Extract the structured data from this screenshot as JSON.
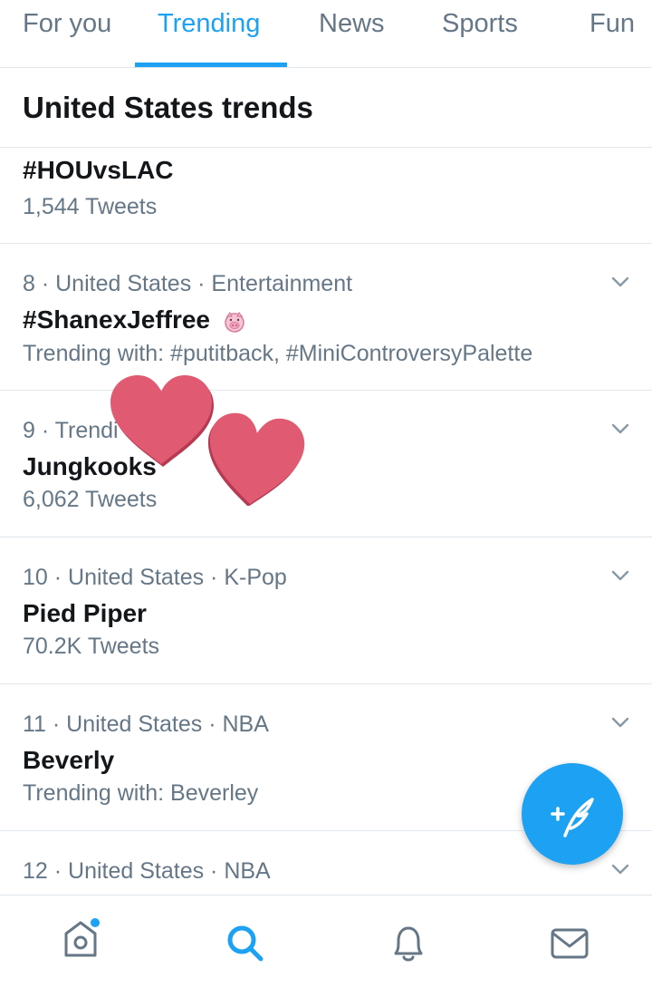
{
  "tabs": [
    {
      "label": "For you"
    },
    {
      "label": "Trending"
    },
    {
      "label": "News"
    },
    {
      "label": "Sports"
    },
    {
      "label": "Fun"
    }
  ],
  "section_title": "United States trends",
  "trends": [
    {
      "meta": "",
      "name": "#HOUvsLAC",
      "sub": "1,544 Tweets"
    },
    {
      "meta": "8 · United States · Entertainment",
      "name": "#ShanexJeffree",
      "sub": "Trending with: #putitback, #MiniControversyPalette"
    },
    {
      "meta": "9 · Trendi",
      "name": "Jungkooks",
      "sub": "6,062 Tweets"
    },
    {
      "meta": "10 · United States · K-Pop",
      "name": "Pied Piper",
      "sub": "70.2K Tweets"
    },
    {
      "meta": "11 · United States · NBA",
      "name": "Beverly",
      "sub": "Trending with: Beverley"
    },
    {
      "meta": "12 · United States · NBA",
      "name": "",
      "sub": ""
    }
  ],
  "colors": {
    "accent": "#1da1f2",
    "heart": "#e05a72"
  }
}
